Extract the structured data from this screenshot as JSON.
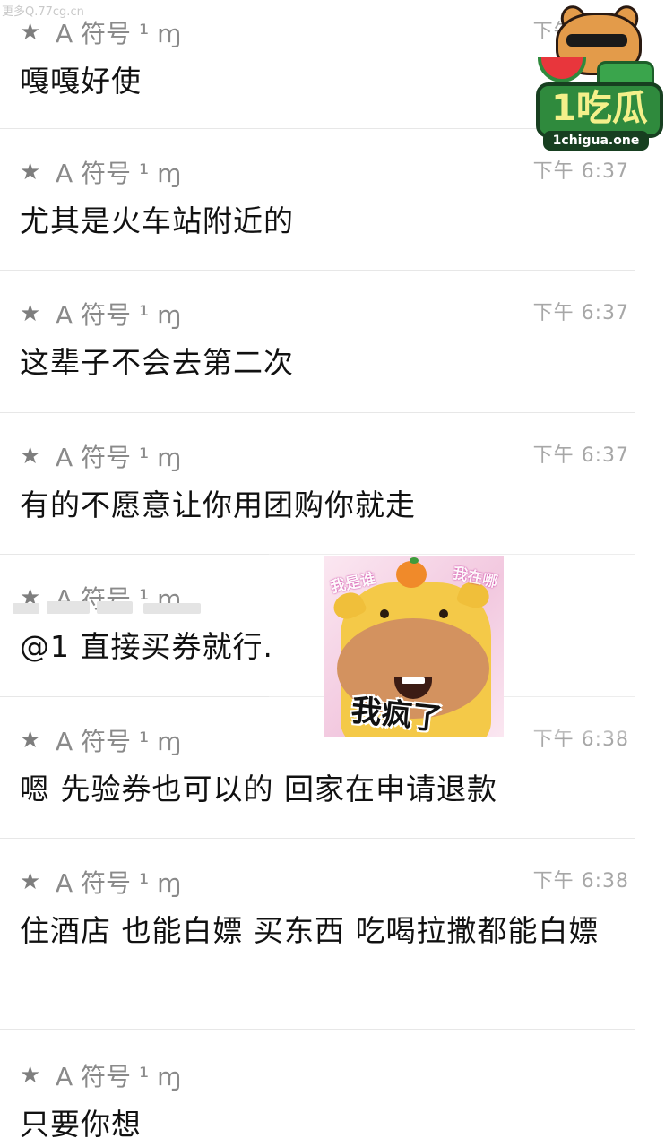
{
  "watermark_top": "更多Q.77cg.cn",
  "logo": {
    "brand": "1吃瓜",
    "domain": "1chigua.one"
  },
  "sender": {
    "icon": "★",
    "name": "A 符号 ¹ ɱ"
  },
  "messages": [
    {
      "name": "A 符号 ¹ ɱ",
      "time": "下午 6:37",
      "text": "嘎嘎好使"
    },
    {
      "name": "A 符号 ¹ ɱ",
      "time": "下午 6:37",
      "text": "尤其是火车站附近的"
    },
    {
      "name": "A 符号 ¹ ɱ",
      "time": "下午 6:37",
      "text": "这辈子不会去第二次"
    },
    {
      "name": "A 符号 ¹ ɱ",
      "time": "下午 6:37",
      "text": "有的不愿意让你用团购你就走"
    },
    {
      "name": "A 符号 ¹ ɱ",
      "time": "",
      "text": "@1 直接买券就行."
    },
    {
      "name": "A 符号 ¹ ɱ",
      "time": "下午 6:38",
      "text": "嗯 先验券也可以的 回家在申请退款"
    },
    {
      "name": "A 符号 ¹ ɱ",
      "time": "下午 6:38",
      "text": "住酒店 也能白嫖 买东西 吃喝拉撒都能白嫖"
    },
    {
      "name": "A 符号 ¹ ɱ",
      "time": "",
      "text": "只要你想"
    }
  ],
  "sticker": {
    "caption": "我疯了",
    "top_left": "我是谁",
    "top_right": "我在哪"
  }
}
